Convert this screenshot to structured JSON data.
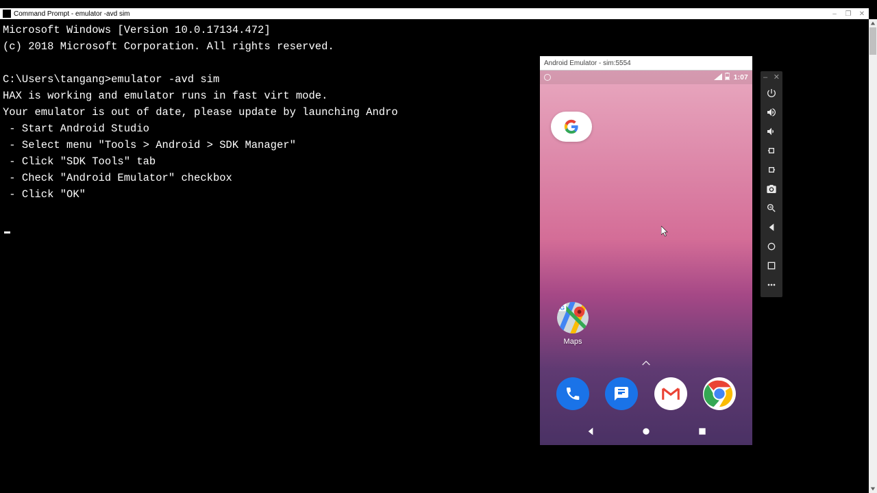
{
  "window": {
    "title": "Command Prompt - emulator -avd sim",
    "controls": {
      "minimize": "–",
      "maximize": "❐",
      "close": "✕"
    }
  },
  "terminal": {
    "lines": [
      "Microsoft Windows [Version 10.0.17134.472]",
      "(c) 2018 Microsoft Corporation. All rights reserved.",
      "",
      "C:\\Users\\tangang>emulator -avd sim",
      "HAX is working and emulator runs in fast virt mode.",
      "Your emulator is out of date, please update by launching Andro",
      " - Start Android Studio",
      " - Select menu \"Tools > Android > SDK Manager\"",
      " - Click \"SDK Tools\" tab",
      " - Check \"Android Emulator\" checkbox",
      " - Click \"OK\""
    ]
  },
  "emulator": {
    "title": "Android Emulator - sim:5554",
    "statusbar": {
      "time": "1:07"
    },
    "apps": {
      "maps_label": "Maps",
      "google_search": "Google",
      "phone": "Phone",
      "messages": "Messages",
      "gmail": "Gmail",
      "chrome": "Chrome"
    },
    "nav": {
      "back": "Back",
      "home": "Home",
      "overview": "Overview"
    },
    "toolbar": {
      "minimize": "–",
      "close": "✕",
      "power": "Power",
      "volume_up": "Volume up",
      "volume_down": "Volume down",
      "rotate_left": "Rotate left",
      "rotate_right": "Rotate right",
      "screenshot": "Take screenshot",
      "zoom": "Zoom",
      "back": "Back",
      "home": "Home",
      "overview": "Overview",
      "more": "More"
    }
  }
}
